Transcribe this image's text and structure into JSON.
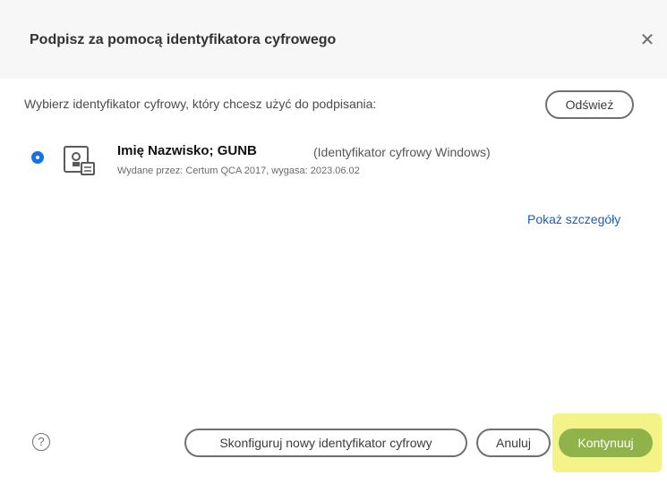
{
  "dialog": {
    "title": "Podpisz za pomocą identyfikatora cyfrowego",
    "close_icon": "close-icon"
  },
  "prompt": "Wybierz identyfikator cyfrowy, który chcesz użyć do podpisania:",
  "refresh_label": "Odśwież",
  "identity": {
    "name": "Imię Nazwisko; GUNB",
    "type": "(Identyfikator cyfrowy Windows)",
    "issuer": "Wydane przez: Certum QCA 2017, wygasa: 2023.06.02",
    "icon": "certificate-icon",
    "selected": true
  },
  "details_link": "Pokaż szczegóły",
  "footer": {
    "help_icon": "help-icon",
    "help_glyph": "?",
    "configure_label": "Skonfiguruj nowy identyfikator cyfrowy",
    "cancel_label": "Anuluj",
    "continue_label": "Kontynuuj"
  },
  "colors": {
    "accent": "#1473e6",
    "link": "#1a5fb4",
    "continue_button": "#8fb34a",
    "highlight": "#f3f388"
  }
}
